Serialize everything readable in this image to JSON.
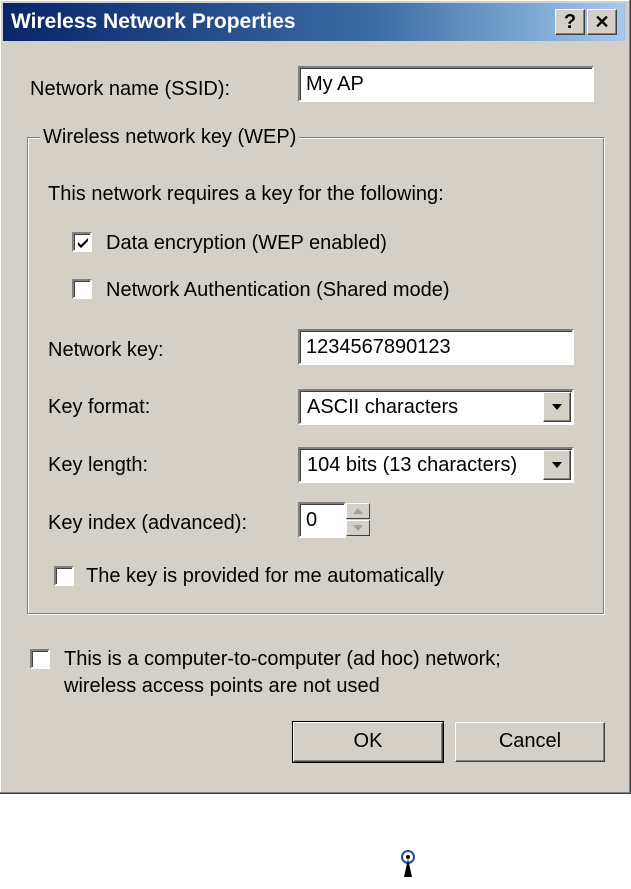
{
  "window": {
    "title": "Wireless Network Properties",
    "help_label": "?",
    "close_label": "✕"
  },
  "ssid": {
    "label": "Network name (SSID):",
    "value": "My AP"
  },
  "wep_group": {
    "legend": "Wireless network key (WEP)",
    "requires_text": "This network requires a key for the following:",
    "data_encryption": {
      "label": "Data encryption (WEP enabled)",
      "checked": true
    },
    "network_auth": {
      "label": "Network Authentication (Shared mode)",
      "checked": false
    },
    "network_key": {
      "label": "Network key:",
      "value": "1234567890123"
    },
    "key_format": {
      "label": "Key format:",
      "value": "ASCII characters"
    },
    "key_length": {
      "label": "Key length:",
      "value": "104 bits (13 characters)"
    },
    "key_index": {
      "label": "Key index (advanced):",
      "value": "0"
    },
    "auto_key": {
      "label": "The key is provided for me automatically",
      "checked": false
    }
  },
  "adhoc": {
    "line1": "This is a computer-to-computer (ad hoc) network;",
    "line2": "wireless access points are not used",
    "checked": false
  },
  "buttons": {
    "ok": "OK",
    "cancel": "Cancel"
  },
  "colors": {
    "face": "#d4d0c8",
    "title_start": "#0a246a",
    "title_end": "#a6caf0"
  },
  "icons": {
    "tray": "wireless-antenna-icon"
  }
}
